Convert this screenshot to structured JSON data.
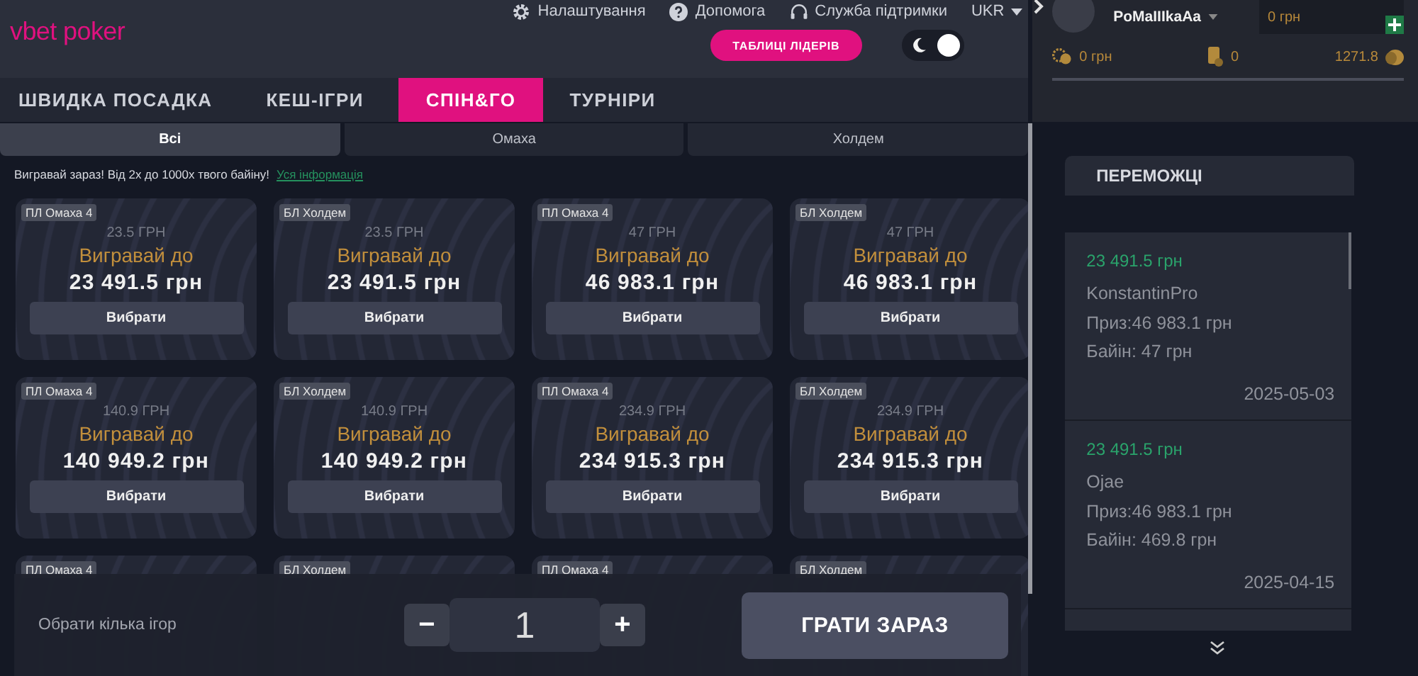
{
  "header": {
    "logo": "vbet poker",
    "top_links": [
      {
        "kind": "settings",
        "label": "Налаштування"
      },
      {
        "kind": "help",
        "label": "Допомога"
      },
      {
        "kind": "support",
        "label": "Служба підтримки"
      }
    ],
    "language": "UKR",
    "leaderboard_button": "ТАБЛИЦІ ЛІДЕРІВ",
    "dark_mode": true
  },
  "account": {
    "username": "PoMaIIIkaAa",
    "balance": "0 грн",
    "chips": "0 грн",
    "tickets": "0",
    "points": "1271.8"
  },
  "nav_tabs": [
    {
      "label": "ШВИДКА ПОСАДКА",
      "selected": false
    },
    {
      "label": "КЕШ-ІГРИ",
      "selected": false
    },
    {
      "label": "СПІН&ГО",
      "selected": true
    },
    {
      "label": "ТУРНІРИ",
      "selected": false
    }
  ],
  "sub_tabs": [
    {
      "label": "Всі",
      "selected": true
    },
    {
      "label": "Омаха",
      "selected": false
    },
    {
      "label": "Холдем",
      "selected": false
    }
  ],
  "promo": {
    "text": "Вигравай зараз! Від 2х до 1000х твого байіну!",
    "link": "Уся інформація"
  },
  "games": [
    {
      "tag": "ПЛ Омаха 4",
      "buy_in": "23.5 ГРН",
      "win_label": "Вигравай до",
      "prize": "23 491.5 грн",
      "button": "Вибрати"
    },
    {
      "tag": "БЛ Холдем",
      "buy_in": "23.5 ГРН",
      "win_label": "Вигравай до",
      "prize": "23 491.5 грн",
      "button": "Вибрати"
    },
    {
      "tag": "ПЛ Омаха 4",
      "buy_in": "47 ГРН",
      "win_label": "Вигравай до",
      "prize": "46 983.1 грн",
      "button": "Вибрати"
    },
    {
      "tag": "БЛ Холдем",
      "buy_in": "47 ГРН",
      "win_label": "Вигравай до",
      "prize": "46 983.1 грн",
      "button": "Вибрати"
    },
    {
      "tag": "ПЛ Омаха 4",
      "buy_in": "140.9 ГРН",
      "win_label": "Вигравай до",
      "prize": "140 949.2 грн",
      "button": "Вибрати"
    },
    {
      "tag": "БЛ Холдем",
      "buy_in": "140.9 ГРН",
      "win_label": "Вигравай до",
      "prize": "140 949.2 грн",
      "button": "Вибрати"
    },
    {
      "tag": "ПЛ Омаха 4",
      "buy_in": "234.9 ГРН",
      "win_label": "Вигравай до",
      "prize": "234 915.3 грн",
      "button": "Вибрати"
    },
    {
      "tag": "БЛ Холдем",
      "buy_in": "234.9 ГРН",
      "win_label": "Вигравай до",
      "prize": "234 915.3 грн",
      "button": "Вибрати"
    },
    {
      "tag": "ПЛ Омаха 4"
    },
    {
      "tag": "БЛ Холдем"
    },
    {
      "tag": "ПЛ Омаха 4"
    },
    {
      "tag": "БЛ Холдем"
    }
  ],
  "bottom_bar": {
    "label": "Обрати кілька ігор",
    "minus": "−",
    "count": "1",
    "plus": "+",
    "play_button": "ГРАТИ ЗАРАЗ"
  },
  "winners": {
    "title": "ПЕРЕМОЖЦІ",
    "items": [
      {
        "amount": "23 491.5 грн",
        "name": "KonstantinPro",
        "prize": "Приз:46 983.1 грн",
        "buy_in": "Байін: 47 грн",
        "date": "2025-05-03"
      },
      {
        "amount": "23 491.5 грн",
        "name": "Ojae",
        "prize": "Приз:46 983.1 грн",
        "buy_in": "Байін: 469.8 грн",
        "date": "2025-04-15"
      }
    ]
  }
}
